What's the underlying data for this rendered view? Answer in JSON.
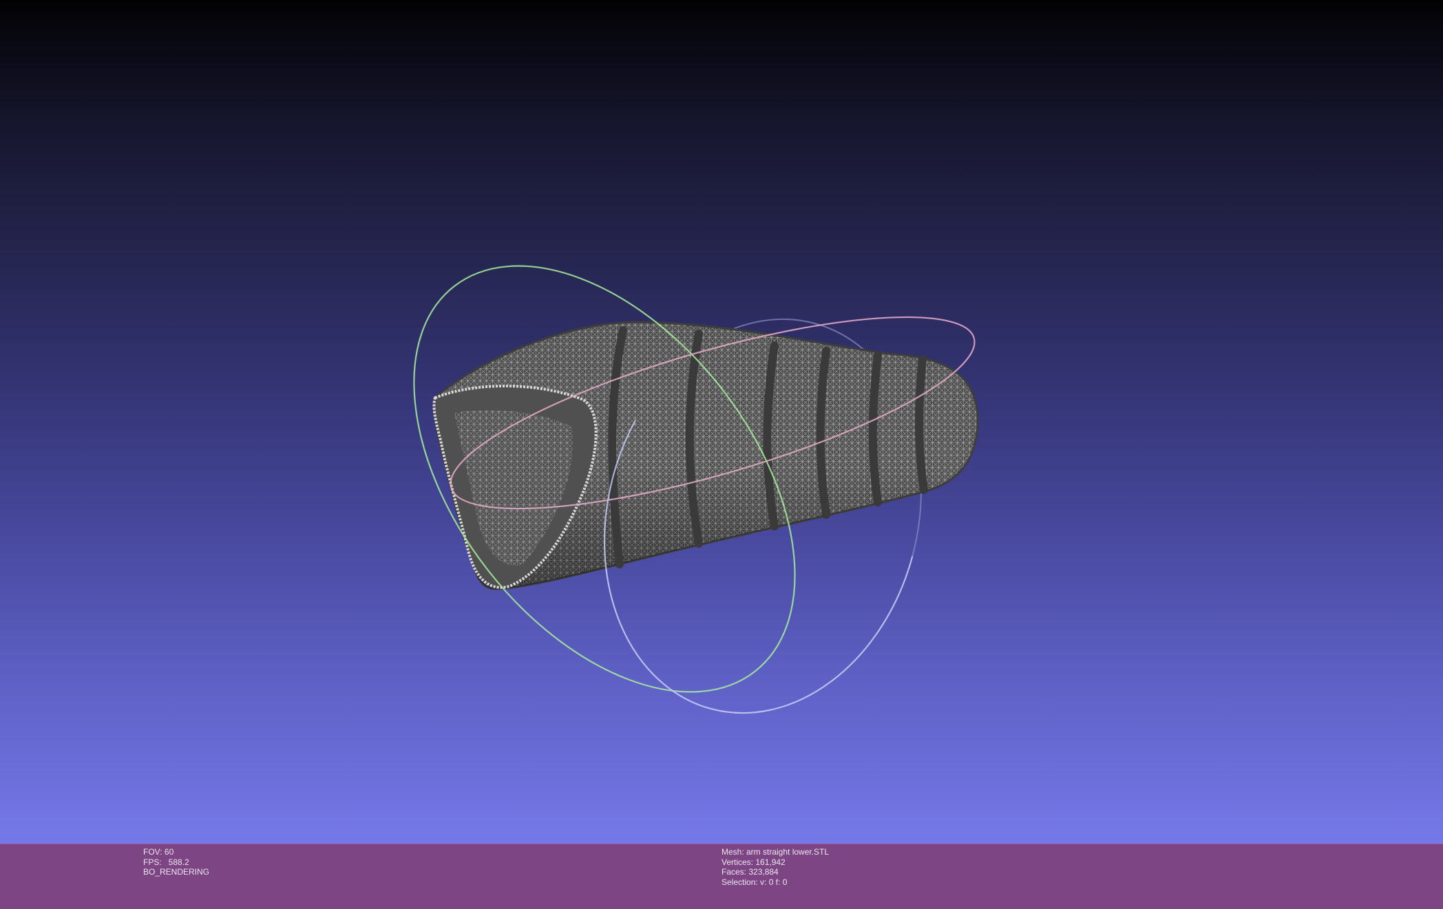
{
  "viewport": {
    "background_top": "#020204",
    "background_bottom": "#7579e8",
    "mesh_color": "#5a5a5a",
    "trackball": {
      "x_ring_color": "#e0a8c4",
      "y_ring_color": "#a7ee9e",
      "z_ring_color": "#c4c8f4"
    }
  },
  "status": {
    "left": {
      "fov": "FOV: 60",
      "fps_label": "FPS:",
      "fps_value": "588.2",
      "render_mode": "BO_RENDERING"
    },
    "right": {
      "mesh": "Mesh: arm straight lower.STL",
      "vertices": "Vertices: 161,942",
      "faces": "Faces: 323,884",
      "selection": "Selection: v: 0 f: 0"
    },
    "bar_color": "#7e4585"
  }
}
